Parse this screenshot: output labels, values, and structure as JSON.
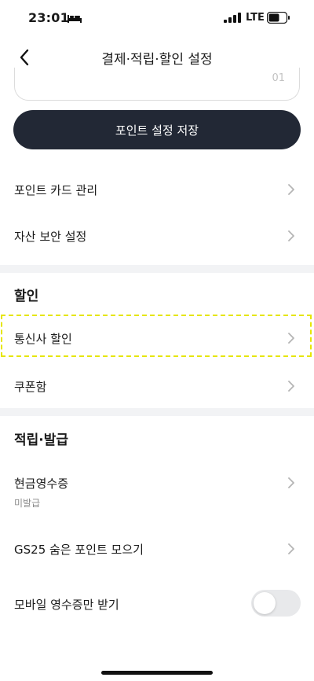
{
  "status_bar": {
    "time": "23:01",
    "network": "LTE",
    "icons": [
      "bed-icon",
      "signal-icon",
      "battery-icon"
    ]
  },
  "nav": {
    "title": "결제·적립·할인 설정",
    "back_icon": "chevron-left-icon"
  },
  "point_input": {
    "suffix": "01"
  },
  "save_button": {
    "label": "포인트 설정 저장"
  },
  "menu_top": {
    "point_card": "포인트 카드 관리",
    "asset_security": "자산 보안 설정"
  },
  "discount_section": {
    "title": "할인",
    "telecom": "통신사 할인",
    "coupon": "쿠폰함"
  },
  "accrual_section": {
    "title": "적립·발급",
    "cash_receipt": "현금영수증",
    "cash_receipt_status": "미발급",
    "gs25_points": "GS25 숨은 포인트 모으기",
    "mobile_receipt": "모바일 영수증만 받기"
  },
  "mobile_receipt_toggle": {
    "enabled": false
  },
  "colors": {
    "primary_button": "#222835",
    "divider": "#f2f3f5",
    "highlight": "#e6e600",
    "toggle_off": "#e8e9eb"
  }
}
